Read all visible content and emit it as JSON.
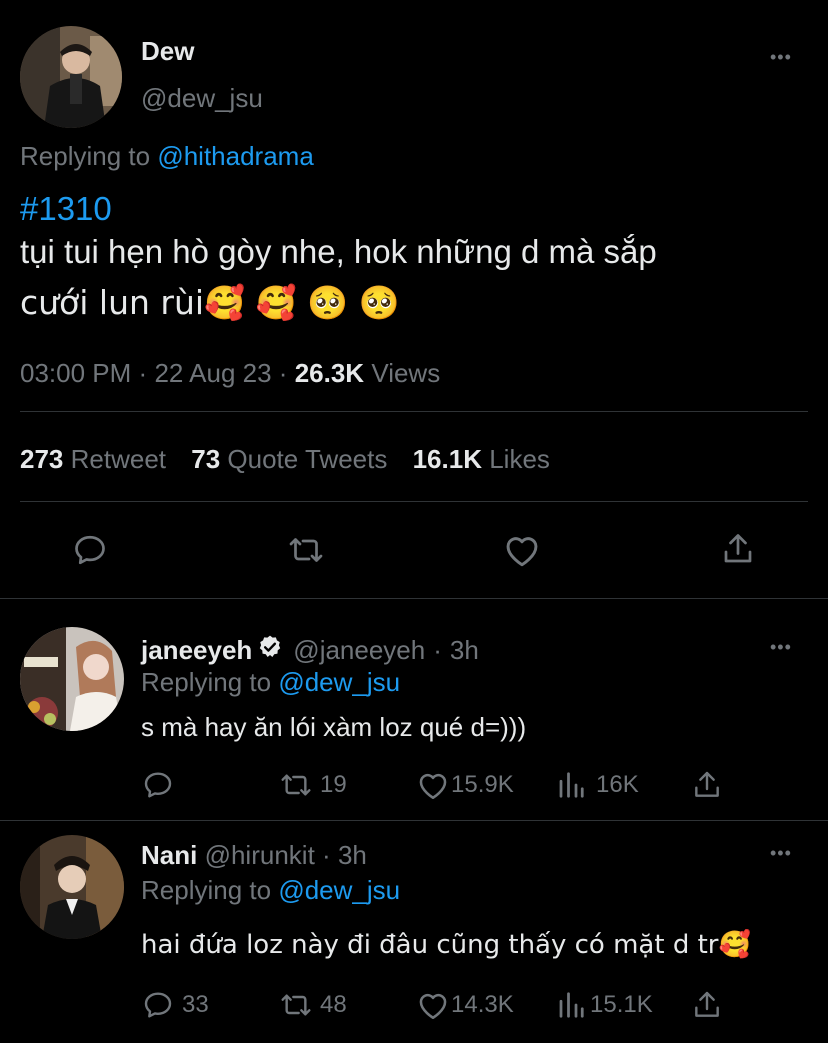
{
  "main_tweet": {
    "display_name": "Dew",
    "handle": "@dew_jsu",
    "replying_prefix": "Replying to ",
    "replying_handle": "@hithadrama",
    "hashtag": "#1310",
    "text_line1": "tụi tui hẹn hò gòy nhe, hok những d mà sắp",
    "text_line2": "cưới lun rùi🥰 🥰 🥺 🥺",
    "time": "03:00 PM",
    "date": "22 Aug 23",
    "views_count": "26.3K",
    "views_label": "Views",
    "retweets_count": "273",
    "retweets_label": "Retweet",
    "quotes_count": "73",
    "quotes_label": "Quote Tweets",
    "likes_count": "16.1K",
    "likes_label": "Likes"
  },
  "replies": [
    {
      "display_name": "janeeyeh",
      "verified": true,
      "handle": "@janeeyeh",
      "time": "3h",
      "replying_prefix": "Replying to ",
      "replying_handle": "@dew_jsu",
      "text": "s mà hay ăn lói xàm loz qué d=)))",
      "reply_count": "",
      "retweet_count": "19",
      "like_count": "15.9K",
      "view_count": "16K"
    },
    {
      "display_name": "Nani",
      "verified": false,
      "handle": "@hirunkit",
      "time": "3h",
      "replying_prefix": "Replying to ",
      "replying_handle": "@dew_jsu",
      "text": "hai đứa loz này đi đâu cũng thấy có mặt d tr🥰",
      "reply_count": "33",
      "retweet_count": "48",
      "like_count": "14.3K",
      "view_count": "15.1K"
    }
  ],
  "more_glyph": "•••",
  "separator": "·",
  "icons": [
    "reply-icon",
    "retweet-icon",
    "like-icon",
    "share-icon",
    "views-icon",
    "verified-badge-icon",
    "more-icon"
  ],
  "colors": {
    "background": "#000000",
    "text": "#e7e9ea",
    "secondary": "#71767b",
    "link": "#1d9bf0",
    "divider": "#2f3336"
  }
}
